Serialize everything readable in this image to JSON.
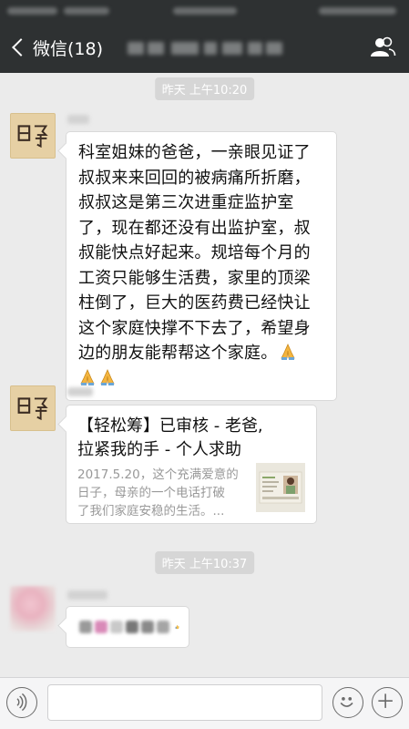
{
  "nav": {
    "back_label": "微信(18)",
    "back_icon": "chevron-left-icon",
    "group_info_icon": "people-icon"
  },
  "messages": {
    "ts1": "昨天 上午10:20",
    "msg1_lines": [
      "科室姐妹的爸爸，一亲眼见证了",
      "叔叔来来回回的被病痛所折磨，",
      "叔叔这是第三次进重症监护室",
      "了，现在都还没有出监护室，叔",
      "叔能快点好起来。规培每个月的",
      "工资只能够生活费，家里的顶梁",
      "柱倒了，巨大的医药费已经快让",
      "这个家庭快撑不下去了，希望身",
      "边的朋友能帮帮这个家庭。"
    ],
    "msg2": {
      "title_line1": "【轻松筹】已审核 - 老爸,",
      "title_line2": "拉紧我的手 - 个人求助",
      "desc_line1": "2017.5.20，这个充满爱意的",
      "desc_line2": "日子，母亲的一个电话打破",
      "desc_line3": "了我们家庭安稳的生活。..."
    },
    "ts2": "昨天 上午10:37"
  },
  "inputbar": {
    "voice_icon": "voice-icon",
    "emoji_icon": "emoji-icon",
    "more_icon": "plus-icon"
  },
  "colors": {
    "navbar": "#2e3132",
    "chat_bg": "#ebebeb",
    "bubble": "#ffffff"
  }
}
